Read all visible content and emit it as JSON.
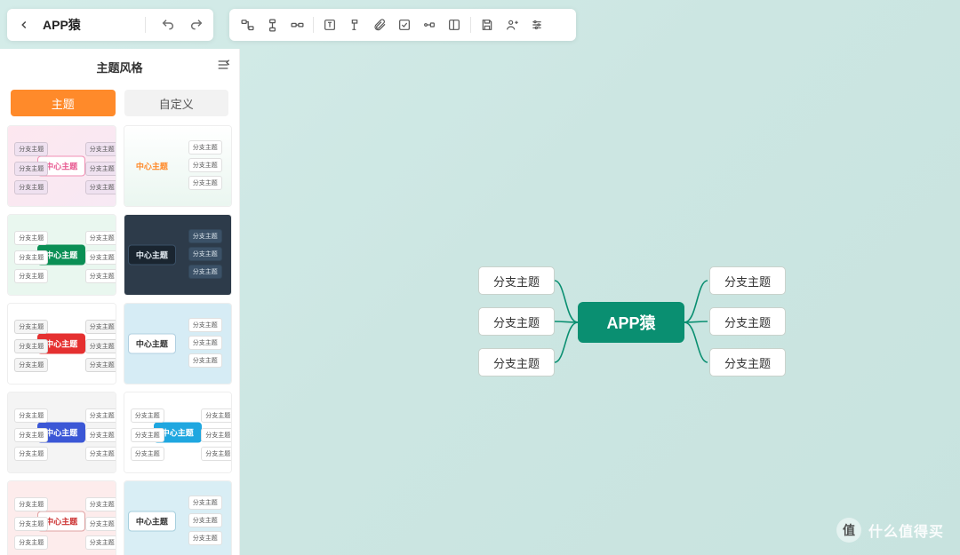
{
  "header": {
    "title": "APP猿"
  },
  "sidebar": {
    "title": "主题风格",
    "tabs": {
      "theme": "主题",
      "custom": "自定义"
    },
    "themePreview": {
      "centerLabel": "中心主题",
      "branchLabel": "分支主题"
    }
  },
  "mindmap": {
    "center": "APP猿",
    "branches": {
      "l1": "分支主题",
      "l2": "分支主题",
      "l3": "分支主题",
      "r1": "分支主题",
      "r2": "分支主题",
      "r3": "分支主题"
    }
  },
  "watermark": {
    "badge": "值",
    "text": "什么值得买"
  },
  "themeStyles": [
    {
      "bg": "linear-gradient(135deg,#fde7ef,#f7e9f4)",
      "center": "#fff",
      "centerBorder": "#f28fb4",
      "centerColor": "#e85b92",
      "node": "#efe1f0"
    },
    {
      "bg": "linear-gradient(180deg,#ffffff,#eaf6f0)",
      "center": "transparent",
      "centerBorder": "transparent",
      "centerColor": "#ff8a2a",
      "node": "#fff",
      "layout": "right"
    },
    {
      "bg": "linear-gradient(180deg,#e9f7ef,#e9f7ef)",
      "center": "#0a8f55",
      "centerBorder": "#0a8f55",
      "centerColor": "#fff",
      "node": "#fff"
    },
    {
      "bg": "linear-gradient(180deg,#2d3b4a,#2d3b4a)",
      "center": "#1a2530",
      "centerBorder": "#3b5167",
      "centerColor": "#e1e9f0",
      "node": "#3b5167",
      "layout": "right",
      "nodeColor": "#dfe8ef"
    },
    {
      "bg": "linear-gradient(180deg,#ffffff,#ffffff)",
      "center": "#e53030",
      "centerBorder": "#e53030",
      "centerColor": "#fff",
      "node": "#f5f5f5"
    },
    {
      "bg": "linear-gradient(180deg,#d6ecf5,#d6ecf5)",
      "center": "#fff",
      "centerBorder": "#b0cfe0",
      "centerColor": "#333",
      "node": "#fff",
      "layout": "right"
    },
    {
      "bg": "linear-gradient(180deg,#f4f4f4,#f4f4f4)",
      "center": "#3b57d6",
      "centerBorder": "#3b57d6",
      "centerColor": "#fff",
      "node": "#fff"
    },
    {
      "bg": "linear-gradient(180deg,#ffffff,#ffffff)",
      "center": "#1fa7e0",
      "centerBorder": "#1fa7e0",
      "centerColor": "#fff",
      "node": "#fff"
    },
    {
      "bg": "linear-gradient(180deg,#fdecec,#fdecec)",
      "center": "#fff",
      "centerBorder": "#e0a2a2",
      "centerColor": "#c33",
      "node": "#fff"
    },
    {
      "bg": "linear-gradient(180deg,#d9eef5,#d9eef5)",
      "center": "#fff",
      "centerBorder": "#a7cfdd",
      "centerColor": "#333",
      "node": "#fff",
      "layout": "right"
    }
  ]
}
